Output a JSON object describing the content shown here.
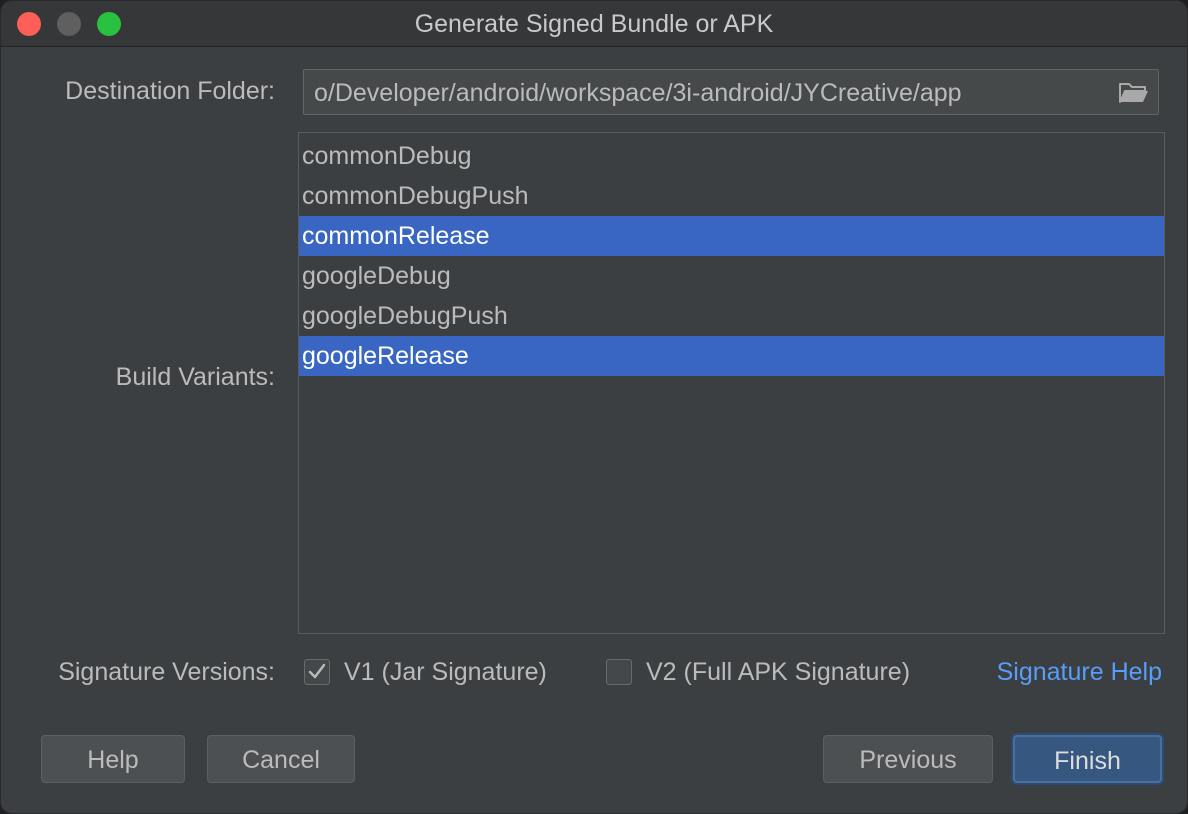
{
  "window": {
    "title": "Generate Signed Bundle or APK"
  },
  "destination": {
    "label": "Destination Folder:",
    "value": "o/Developer/android/workspace/3i-android/JYCreative/app",
    "browse_icon": "folder-open-icon"
  },
  "build_variants": {
    "label": "Build Variants:",
    "items": [
      {
        "label": "commonDebug",
        "selected": false
      },
      {
        "label": "commonDebugPush",
        "selected": false
      },
      {
        "label": "commonRelease",
        "selected": true
      },
      {
        "label": "googleDebug",
        "selected": false
      },
      {
        "label": "googleDebugPush",
        "selected": false
      },
      {
        "label": "googleRelease",
        "selected": true
      }
    ]
  },
  "signature": {
    "label": "Signature Versions:",
    "v1": {
      "label": "V1 (Jar Signature)",
      "checked": true
    },
    "v2": {
      "label": "V2 (Full APK Signature)",
      "checked": false
    },
    "help_link": "Signature Help"
  },
  "buttons": {
    "help": "Help",
    "cancel": "Cancel",
    "previous": "Previous",
    "finish": "Finish"
  },
  "colors": {
    "selection": "#3966c2",
    "link": "#589df6",
    "default_button": "#365880"
  }
}
